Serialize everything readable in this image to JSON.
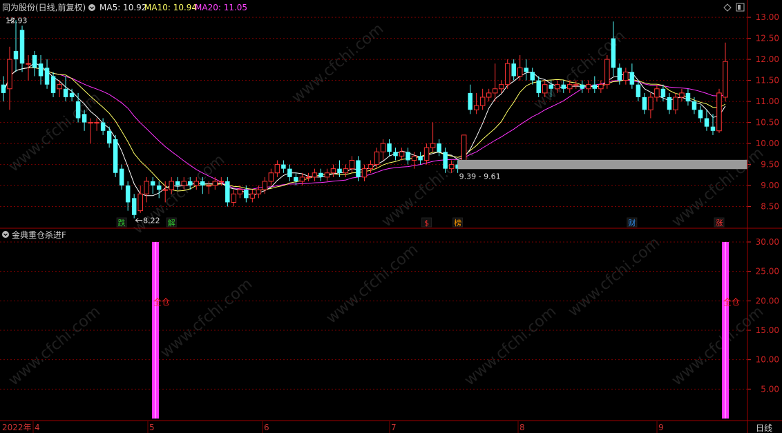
{
  "header": {
    "stock_title": "同为股份(日线,前复权)",
    "ma5_label": "MA5: 10.92",
    "ma10_label": "MA10: 10.94",
    "ma20_label": "MA20: 11.05"
  },
  "indicator_panel": {
    "title": "金典重仓杀进F"
  },
  "footer": {
    "period_button": "日线"
  },
  "colors": {
    "background": "#000000",
    "grid": "#7a0000",
    "axis_text": "#cc2222",
    "up_candle": "#ff3333",
    "down_candle": "#54ffff",
    "ma5": "#ffffff",
    "ma10": "#ffff66",
    "ma20": "#ff33ff",
    "signal_bar": "#ff33ff",
    "zone_band": "#999999"
  },
  "chart_data": [
    {
      "type": "candlestick",
      "title": "同为股份(日线,前复权)",
      "y_ticks": [
        8.5,
        9.0,
        9.5,
        10.0,
        10.5,
        11.0,
        11.5,
        12.0,
        12.5,
        13.0
      ],
      "y_tick_labels": [
        "8.50",
        "9.00",
        "9.50",
        "10.00",
        "10.50",
        "11.00",
        "11.50",
        "12.00",
        "12.50",
        "13.00"
      ],
      "ylim": [
        8.05,
        13.1
      ],
      "x_labels": [
        "2022年",
        "4",
        "5",
        "6",
        "7",
        "8",
        "9"
      ],
      "annotations": [
        {
          "text": "12.93",
          "type": "high_marker"
        },
        {
          "text": "8.22",
          "type": "low_marker"
        },
        {
          "text": "9.39 - 9.61",
          "type": "zone_label",
          "range": [
            9.39,
            9.61
          ]
        }
      ],
      "event_markers": [
        {
          "text": "跌",
          "color": "#33cc33"
        },
        {
          "text": "解",
          "color": "#33cc33"
        },
        {
          "text": "$",
          "color": "#ff3333"
        },
        {
          "text": "榜",
          "color": "#ff9900"
        },
        {
          "text": "财",
          "color": "#3399ff"
        },
        {
          "text": "涨",
          "color": "#ff3333"
        }
      ],
      "ma_latest": {
        "MA5": 10.92,
        "MA10": 10.94,
        "MA20": 11.05
      },
      "candles": [
        {
          "o": 11.4,
          "h": 11.6,
          "l": 11.0,
          "c": 11.2
        },
        {
          "o": 11.3,
          "h": 12.3,
          "l": 10.8,
          "c": 12.0
        },
        {
          "o": 12.2,
          "h": 12.93,
          "l": 11.7,
          "c": 12.0
        },
        {
          "o": 12.7,
          "h": 12.8,
          "l": 11.7,
          "c": 11.9
        },
        {
          "o": 11.9,
          "h": 12.1,
          "l": 11.5,
          "c": 11.9
        },
        {
          "o": 12.1,
          "h": 12.2,
          "l": 11.6,
          "c": 11.8
        },
        {
          "o": 11.9,
          "h": 12.1,
          "l": 11.4,
          "c": 11.6
        },
        {
          "o": 11.8,
          "h": 12.0,
          "l": 11.3,
          "c": 11.4
        },
        {
          "o": 11.6,
          "h": 11.7,
          "l": 11.1,
          "c": 11.2
        },
        {
          "o": 11.3,
          "h": 11.5,
          "l": 11.1,
          "c": 11.4
        },
        {
          "o": 11.3,
          "h": 11.6,
          "l": 11.0,
          "c": 11.1
        },
        {
          "o": 11.2,
          "h": 11.3,
          "l": 11.0,
          "c": 11.1
        },
        {
          "o": 11.0,
          "h": 11.2,
          "l": 10.5,
          "c": 10.6
        },
        {
          "o": 10.7,
          "h": 10.8,
          "l": 10.3,
          "c": 10.5
        },
        {
          "o": 10.5,
          "h": 10.6,
          "l": 10.0,
          "c": 10.5
        },
        {
          "o": 10.5,
          "h": 10.6,
          "l": 10.3,
          "c": 10.5
        },
        {
          "o": 10.5,
          "h": 10.6,
          "l": 10.2,
          "c": 10.3
        },
        {
          "o": 10.3,
          "h": 10.4,
          "l": 9.9,
          "c": 10.0
        },
        {
          "o": 10.1,
          "h": 10.2,
          "l": 9.2,
          "c": 9.3
        },
        {
          "o": 9.4,
          "h": 9.5,
          "l": 8.9,
          "c": 9.0
        },
        {
          "o": 9.0,
          "h": 9.1,
          "l": 8.4,
          "c": 8.6
        },
        {
          "o": 8.7,
          "h": 8.8,
          "l": 8.22,
          "c": 8.3
        },
        {
          "o": 8.4,
          "h": 9.0,
          "l": 8.35,
          "c": 8.8
        },
        {
          "o": 8.8,
          "h": 9.2,
          "l": 8.6,
          "c": 9.1
        },
        {
          "o": 9.1,
          "h": 9.2,
          "l": 8.8,
          "c": 9.0
        },
        {
          "o": 9.0,
          "h": 9.1,
          "l": 8.7,
          "c": 8.9
        },
        {
          "o": 8.9,
          "h": 9.1,
          "l": 8.6,
          "c": 8.9
        },
        {
          "o": 8.9,
          "h": 9.2,
          "l": 8.8,
          "c": 9.1
        },
        {
          "o": 9.1,
          "h": 9.2,
          "l": 8.9,
          "c": 9.0
        },
        {
          "o": 9.0,
          "h": 9.2,
          "l": 8.9,
          "c": 9.1
        },
        {
          "o": 9.1,
          "h": 9.2,
          "l": 8.9,
          "c": 9.0
        },
        {
          "o": 9.0,
          "h": 9.2,
          "l": 8.9,
          "c": 9.1
        },
        {
          "o": 9.1,
          "h": 9.2,
          "l": 8.8,
          "c": 9.0
        },
        {
          "o": 9.0,
          "h": 9.1,
          "l": 8.8,
          "c": 9.0
        },
        {
          "o": 9.0,
          "h": 9.2,
          "l": 8.9,
          "c": 9.1
        },
        {
          "o": 9.1,
          "h": 9.2,
          "l": 9.0,
          "c": 9.1
        },
        {
          "o": 9.1,
          "h": 9.2,
          "l": 8.5,
          "c": 8.6
        },
        {
          "o": 8.6,
          "h": 8.9,
          "l": 8.5,
          "c": 8.8
        },
        {
          "o": 8.8,
          "h": 9.0,
          "l": 8.7,
          "c": 8.9
        },
        {
          "o": 8.9,
          "h": 9.0,
          "l": 8.6,
          "c": 8.7
        },
        {
          "o": 8.7,
          "h": 8.9,
          "l": 8.6,
          "c": 8.8
        },
        {
          "o": 8.8,
          "h": 9.0,
          "l": 8.7,
          "c": 8.9
        },
        {
          "o": 8.9,
          "h": 9.2,
          "l": 8.8,
          "c": 9.1
        },
        {
          "o": 9.1,
          "h": 9.4,
          "l": 9.0,
          "c": 9.3
        },
        {
          "o": 9.3,
          "h": 9.6,
          "l": 9.2,
          "c": 9.5
        },
        {
          "o": 9.5,
          "h": 9.6,
          "l": 9.3,
          "c": 9.4
        },
        {
          "o": 9.4,
          "h": 9.5,
          "l": 9.1,
          "c": 9.2
        },
        {
          "o": 9.2,
          "h": 9.3,
          "l": 9.0,
          "c": 9.1
        },
        {
          "o": 9.1,
          "h": 9.3,
          "l": 9.0,
          "c": 9.2
        },
        {
          "o": 9.2,
          "h": 9.3,
          "l": 9.1,
          "c": 9.2
        },
        {
          "o": 9.2,
          "h": 9.4,
          "l": 9.1,
          "c": 9.3
        },
        {
          "o": 9.3,
          "h": 9.4,
          "l": 9.1,
          "c": 9.2
        },
        {
          "o": 9.2,
          "h": 9.4,
          "l": 9.1,
          "c": 9.3
        },
        {
          "o": 9.3,
          "h": 9.5,
          "l": 9.2,
          "c": 9.4
        },
        {
          "o": 9.4,
          "h": 9.6,
          "l": 9.2,
          "c": 9.3
        },
        {
          "o": 9.3,
          "h": 9.5,
          "l": 9.2,
          "c": 9.4
        },
        {
          "o": 9.4,
          "h": 9.7,
          "l": 9.3,
          "c": 9.6
        },
        {
          "o": 9.6,
          "h": 9.7,
          "l": 9.1,
          "c": 9.2
        },
        {
          "o": 9.2,
          "h": 9.5,
          "l": 9.1,
          "c": 9.4
        },
        {
          "o": 9.4,
          "h": 9.6,
          "l": 9.3,
          "c": 9.5
        },
        {
          "o": 9.5,
          "h": 9.9,
          "l": 9.4,
          "c": 9.8
        },
        {
          "o": 9.8,
          "h": 10.1,
          "l": 9.6,
          "c": 10.0
        },
        {
          "o": 10.0,
          "h": 10.1,
          "l": 9.7,
          "c": 9.8
        },
        {
          "o": 9.8,
          "h": 9.9,
          "l": 9.6,
          "c": 9.7
        },
        {
          "o": 9.7,
          "h": 9.9,
          "l": 9.6,
          "c": 9.8
        },
        {
          "o": 9.8,
          "h": 9.9,
          "l": 9.5,
          "c": 9.6
        },
        {
          "o": 9.6,
          "h": 9.8,
          "l": 9.4,
          "c": 9.7
        },
        {
          "o": 9.7,
          "h": 9.8,
          "l": 9.5,
          "c": 9.6
        },
        {
          "o": 9.6,
          "h": 10.0,
          "l": 9.5,
          "c": 9.9
        },
        {
          "o": 9.9,
          "h": 10.5,
          "l": 9.8,
          "c": 10.0
        },
        {
          "o": 10.0,
          "h": 10.1,
          "l": 9.7,
          "c": 9.8
        },
        {
          "o": 9.8,
          "h": 9.9,
          "l": 9.3,
          "c": 9.4
        },
        {
          "o": 9.4,
          "h": 9.6,
          "l": 9.3,
          "c": 9.5
        },
        {
          "o": 9.5,
          "h": 9.6,
          "l": 9.3,
          "c": 9.4
        },
        {
          "o": 9.5,
          "h": 10.2,
          "l": 9.5,
          "c": 10.2
        },
        {
          "o": 11.2,
          "h": 11.4,
          "l": 10.7,
          "c": 10.8
        },
        {
          "o": 10.8,
          "h": 11.2,
          "l": 10.7,
          "c": 10.9
        },
        {
          "o": 10.9,
          "h": 11.3,
          "l": 10.8,
          "c": 11.1
        },
        {
          "o": 11.1,
          "h": 11.3,
          "l": 11.0,
          "c": 11.2
        },
        {
          "o": 11.2,
          "h": 11.9,
          "l": 11.0,
          "c": 11.3
        },
        {
          "o": 11.3,
          "h": 11.5,
          "l": 11.2,
          "c": 11.4
        },
        {
          "o": 11.4,
          "h": 12.0,
          "l": 11.3,
          "c": 11.9
        },
        {
          "o": 11.9,
          "h": 12.0,
          "l": 11.5,
          "c": 11.6
        },
        {
          "o": 11.6,
          "h": 12.1,
          "l": 11.5,
          "c": 11.8
        },
        {
          "o": 11.8,
          "h": 12.0,
          "l": 11.5,
          "c": 11.7
        },
        {
          "o": 11.7,
          "h": 11.8,
          "l": 11.4,
          "c": 11.5
        },
        {
          "o": 11.5,
          "h": 11.6,
          "l": 11.1,
          "c": 11.2
        },
        {
          "o": 11.2,
          "h": 11.5,
          "l": 11.1,
          "c": 11.4
        },
        {
          "o": 11.4,
          "h": 11.5,
          "l": 11.1,
          "c": 11.3
        },
        {
          "o": 11.3,
          "h": 11.5,
          "l": 11.2,
          "c": 11.4
        },
        {
          "o": 11.4,
          "h": 11.5,
          "l": 11.2,
          "c": 11.3
        },
        {
          "o": 11.3,
          "h": 11.5,
          "l": 11.2,
          "c": 11.4
        },
        {
          "o": 11.4,
          "h": 11.5,
          "l": 11.3,
          "c": 11.4
        },
        {
          "o": 11.4,
          "h": 11.5,
          "l": 11.2,
          "c": 11.3
        },
        {
          "o": 11.3,
          "h": 11.5,
          "l": 11.2,
          "c": 11.4
        },
        {
          "o": 11.4,
          "h": 11.6,
          "l": 11.2,
          "c": 11.3
        },
        {
          "o": 11.3,
          "h": 11.5,
          "l": 11.2,
          "c": 11.4
        },
        {
          "o": 11.4,
          "h": 12.1,
          "l": 11.3,
          "c": 12.0
        },
        {
          "o": 12.5,
          "h": 12.9,
          "l": 11.6,
          "c": 11.8
        },
        {
          "o": 11.8,
          "h": 11.9,
          "l": 11.4,
          "c": 11.5
        },
        {
          "o": 11.5,
          "h": 11.8,
          "l": 11.4,
          "c": 11.7
        },
        {
          "o": 11.7,
          "h": 11.9,
          "l": 11.3,
          "c": 11.4
        },
        {
          "o": 11.4,
          "h": 11.5,
          "l": 11.0,
          "c": 11.1
        },
        {
          "o": 11.1,
          "h": 11.2,
          "l": 10.7,
          "c": 10.8
        },
        {
          "o": 10.8,
          "h": 11.2,
          "l": 10.6,
          "c": 11.1
        },
        {
          "o": 11.1,
          "h": 11.4,
          "l": 11.0,
          "c": 11.3
        },
        {
          "o": 11.3,
          "h": 11.4,
          "l": 11.0,
          "c": 11.1
        },
        {
          "o": 11.1,
          "h": 11.2,
          "l": 10.7,
          "c": 10.8
        },
        {
          "o": 10.8,
          "h": 11.2,
          "l": 10.7,
          "c": 11.1
        },
        {
          "o": 11.1,
          "h": 11.3,
          "l": 11.0,
          "c": 11.2
        },
        {
          "o": 11.2,
          "h": 11.3,
          "l": 10.9,
          "c": 11.0
        },
        {
          "o": 11.0,
          "h": 11.1,
          "l": 10.7,
          "c": 10.8
        },
        {
          "o": 10.8,
          "h": 10.9,
          "l": 10.5,
          "c": 10.6
        },
        {
          "o": 10.6,
          "h": 10.8,
          "l": 10.3,
          "c": 10.4
        },
        {
          "o": 10.4,
          "h": 10.7,
          "l": 10.2,
          "c": 10.3
        },
        {
          "o": 10.3,
          "h": 11.3,
          "l": 10.25,
          "c": 11.2
        },
        {
          "o": 11.1,
          "h": 12.4,
          "l": 11.0,
          "c": 11.95
        }
      ]
    },
    {
      "type": "bar",
      "title": "金典重仓杀进F",
      "y_ticks": [
        5,
        10,
        15,
        20,
        25,
        30
      ],
      "y_tick_labels": [
        "5.00",
        "10.00",
        "15.00",
        "20.00",
        "25.00",
        "30.00"
      ],
      "ylim": [
        0,
        30.7
      ],
      "signals": [
        {
          "label": "全仓",
          "value": 30,
          "month_tick": "5"
        },
        {
          "label": "全仓",
          "value": 30,
          "month_tick": "9"
        }
      ]
    }
  ]
}
